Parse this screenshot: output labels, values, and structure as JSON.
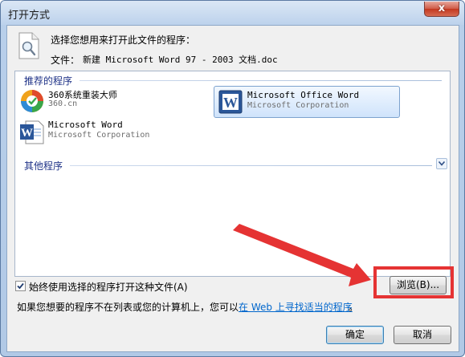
{
  "window": {
    "title": "打开方式",
    "close_label": "x"
  },
  "header": {
    "prompt": "选择您想用来打开此文件的程序：",
    "file_label": "文件：",
    "file_name": "新建 Microsoft Word 97 - 2003 文档.doc"
  },
  "recommended": {
    "title": "推荐的程序",
    "apps": [
      {
        "name": "360系统重装大师",
        "publisher": "360.cn"
      },
      {
        "name": "Microsoft Office Word",
        "publisher": "Microsoft Corporation",
        "selected": true
      },
      {
        "name": "Microsoft Word",
        "publisher": "Microsoft Corporation"
      }
    ]
  },
  "other": {
    "title": "其他程序"
  },
  "always_use": {
    "label": "始终使用选择的程序打开这种文件(A)",
    "checked": true
  },
  "hint": {
    "text": "如果您想要的程序不在列表或您的计算机上，您可以",
    "link": "在 Web 上寻找适当的程序",
    "suffix": "。"
  },
  "buttons": {
    "browse": "浏览(B)...",
    "ok": "确定",
    "cancel": "取消"
  },
  "colors": {
    "annotation_red": "#e53333",
    "link_blue": "#0066cc",
    "group_title": "#1e3287"
  }
}
